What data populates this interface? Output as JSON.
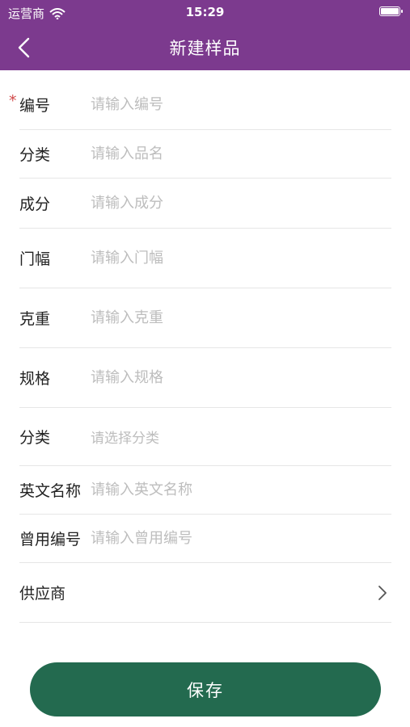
{
  "status": {
    "carrier": "运营商",
    "time": "15:29"
  },
  "nav": {
    "title": "新建样品"
  },
  "form": {
    "fields": [
      {
        "label": "编号",
        "placeholder": "请输入编号",
        "required": "*"
      },
      {
        "label": "分类",
        "placeholder": "请输入品名"
      },
      {
        "label": "成分",
        "placeholder": "请输入成分"
      },
      {
        "label": "门幅",
        "placeholder": "请输入门幅"
      },
      {
        "label": "克重",
        "placeholder": "请输入克重"
      },
      {
        "label": "规格",
        "placeholder": "请输入规格"
      },
      {
        "label": "分类",
        "placeholder": "请选择分类"
      },
      {
        "label": "英文名称",
        "placeholder": "请输入英文名称"
      },
      {
        "label": "曾用编号",
        "placeholder": "请输入曾用编号"
      },
      {
        "label": "供应商"
      }
    ]
  },
  "actions": {
    "save_label": "保存"
  },
  "colors": {
    "header": "#7c3a8e",
    "save_button": "#236a4f",
    "required_mark": "#d14b4b",
    "placeholder": "#bdbdbd"
  },
  "icons": [
    "wifi-icon",
    "battery-icon",
    "back-arrow-icon",
    "chevron-right-icon"
  ]
}
